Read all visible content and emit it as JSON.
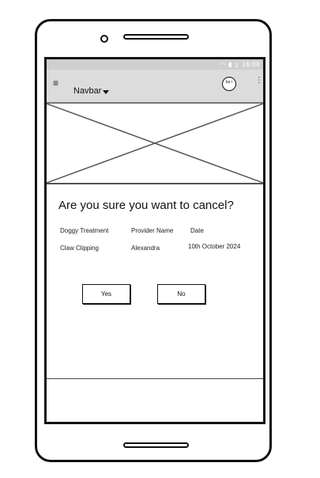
{
  "status_bar": {
    "icons": [
      "wifi-icon",
      "signal-icon",
      "battery-icon"
    ],
    "time": "16:08"
  },
  "navbar": {
    "title": "Navbar",
    "avatar_text": "ba r",
    "menu_glyph": "⋮",
    "hamburger_glyph": "≡"
  },
  "dialog": {
    "title": "Are you sure you want to cancel?",
    "headers": [
      "Doggy Treatment",
      "Provider Name",
      "Date"
    ],
    "row": [
      "Claw Clipping",
      "Alexandra",
      "10th October 2024"
    ],
    "yes_label": "Yes",
    "no_label": "No"
  }
}
